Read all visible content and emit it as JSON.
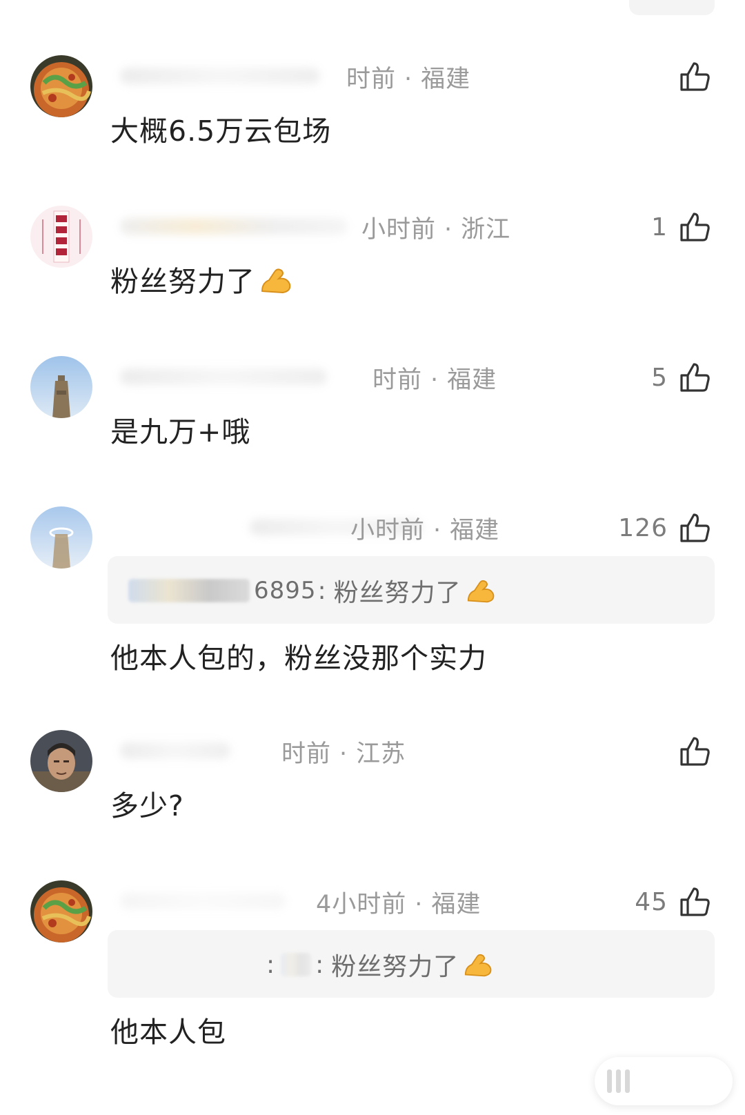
{
  "comments": [
    {
      "time": "时前",
      "region": "福建",
      "likes": "",
      "text": "大概6.5万云包场",
      "avatar": "food-bowl-avatar"
    },
    {
      "time": "小时前",
      "region": "浙江",
      "likes": "1",
      "text": "粉丝努力了",
      "emoji": "flexed-biceps",
      "avatar": "calligraphy-avatar"
    },
    {
      "time": "时前",
      "region": "福建",
      "likes": "5",
      "text": "是九万+哦",
      "avatar": "tower-avatar"
    },
    {
      "time": "小时前",
      "region": "福建",
      "likes": "126",
      "text": "他本人包的，粉丝没那个实力",
      "avatar": "bottle-sky-avatar",
      "quote": {
        "author": "6895",
        "sep": ":",
        "text": "粉丝努力了",
        "emoji": "flexed-biceps"
      }
    },
    {
      "time": "时前",
      "region": "江苏",
      "likes": "",
      "text": "多少?",
      "avatar": "man-portrait-avatar"
    },
    {
      "time": "4小时前",
      "region": "福建",
      "likes": "45",
      "text": "他本人包",
      "avatar": "food-bowl-avatar",
      "quote": {
        "author": "",
        "sep": ":",
        "text": "粉丝努力了",
        "emoji": "flexed-biceps"
      }
    }
  ],
  "meta_separator": "·",
  "icons": {
    "like": "thumbs-up-icon"
  },
  "colors": {
    "text": "#222222",
    "meta": "#9a9a9a",
    "quote_bg": "#f5f5f5"
  }
}
